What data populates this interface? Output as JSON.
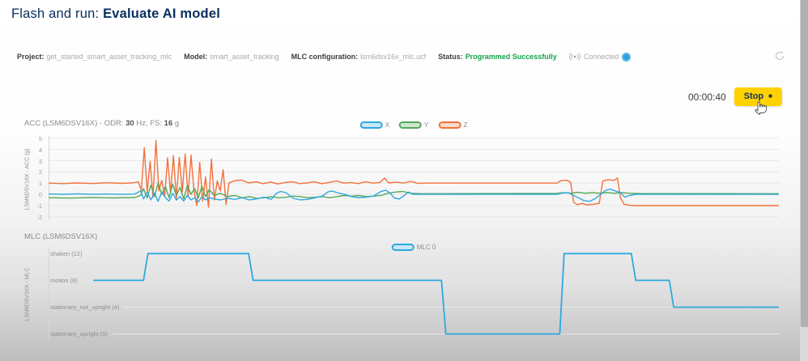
{
  "page": {
    "title_prefix": "Flash and run: ",
    "title_emphasis": "Evaluate AI model"
  },
  "info_bar": {
    "project_label": "Project:",
    "project_value": "get_started_smart_asset_tracking_mlc",
    "model_label": "Model:",
    "model_value": "smart_asset_tracking",
    "mlc_label": "MLC configuration:",
    "mlc_value": "lsm6dsv16x_mlc.ucf",
    "status_label": "Status:",
    "status_value": "Programmed Successfully",
    "connected_label": "Connected"
  },
  "toolbar": {
    "timer": "00:00:40",
    "stop_label": "Stop",
    "stop_glyph": "■"
  },
  "colors": {
    "navy": "#0c2f60",
    "status_green": "#16a34a",
    "stop_yellow": "#ffd200",
    "series_x": "#2ea9e0",
    "series_x_fill": "#c9e7f7",
    "series_y": "#55a85a",
    "series_y_fill": "#cfe6cf",
    "series_z": "#f4713c",
    "series_z_fill": "#fcd9c8",
    "mlc0": "#2ea9e0",
    "mlc0_fill": "#c9e7f7"
  },
  "chart_data": [
    {
      "type": "line",
      "title": {
        "prefix": "ACC (LSM6DSV16X) - ODR: ",
        "odr": "30",
        "mid": " Hz, FS: ",
        "fs": "16",
        "suffix": " g"
      },
      "ylabel": "LSM6DSV16X - ACC (g)",
      "ylim": [
        -2.3,
        5.2
      ],
      "grid": true,
      "legend_position": "top-center",
      "line_width": 1.4,
      "yticks": [
        {
          "value": 5,
          "label": "5"
        },
        {
          "value": 4,
          "label": "4"
        },
        {
          "value": 3,
          "label": "3"
        },
        {
          "value": 2,
          "label": "2"
        },
        {
          "value": 1,
          "label": "1"
        },
        {
          "value": 0,
          "label": "0"
        },
        {
          "value": -1,
          "label": "-1"
        },
        {
          "value": -2,
          "label": "-2"
        }
      ],
      "legend": [
        {
          "label": "X",
          "color_key": "series_x",
          "fill_key": "series_x_fill"
        },
        {
          "label": "Y",
          "color_key": "series_y",
          "fill_key": "series_y_fill"
        },
        {
          "label": "Z",
          "color_key": "series_z",
          "fill_key": "series_z_fill"
        }
      ],
      "series": [
        {
          "name": "Z",
          "color_key": "series_z",
          "points": [
            [
              0,
              1
            ],
            [
              2,
              0.96
            ],
            [
              4,
              1.02
            ],
            [
              6,
              0.97
            ],
            [
              8,
              1.03
            ],
            [
              10,
              0.98
            ],
            [
              11.5,
              1.02
            ],
            [
              12.3,
              1.12
            ],
            [
              12.7,
              0.35
            ],
            [
              13.1,
              4.15
            ],
            [
              13.5,
              0.2
            ],
            [
              13.9,
              2.95
            ],
            [
              14.3,
              -0.25
            ],
            [
              14.7,
              4.8
            ],
            [
              15.1,
              0.3
            ],
            [
              15.5,
              1.25
            ],
            [
              15.9,
              -0.2
            ],
            [
              16.3,
              3.25
            ],
            [
              16.7,
              0.1
            ],
            [
              17.1,
              3.45
            ],
            [
              17.5,
              -0.4
            ],
            [
              17.9,
              3.3
            ],
            [
              18.3,
              0.2
            ],
            [
              18.7,
              3.6
            ],
            [
              19.1,
              -0.2
            ],
            [
              19.5,
              3.5
            ],
            [
              19.9,
              0.4
            ],
            [
              20.3,
              -1
            ],
            [
              20.7,
              2.85
            ],
            [
              21.1,
              -0.6
            ],
            [
              21.5,
              1.55
            ],
            [
              21.9,
              -1.15
            ],
            [
              22.3,
              3.15
            ],
            [
              22.7,
              -0.5
            ],
            [
              23.1,
              1.2
            ],
            [
              23.5,
              0.3
            ],
            [
              23.9,
              2.2
            ],
            [
              24.3,
              -0.9
            ],
            [
              24.7,
              1.0
            ],
            [
              25.4,
              1.2
            ],
            [
              26.4,
              1.28
            ],
            [
              27.4,
              1.02
            ],
            [
              28.4,
              1.12
            ],
            [
              29.4,
              0.95
            ],
            [
              30.4,
              1.1
            ],
            [
              31.4,
              0.92
            ],
            [
              32.4,
              1.06
            ],
            [
              33.4,
              1.12
            ],
            [
              34.4,
              0.96
            ],
            [
              35.4,
              1.02
            ],
            [
              36.4,
              1.12
            ],
            [
              37.4,
              0.95
            ],
            [
              38.4,
              1.06
            ],
            [
              39.4,
              1.2
            ],
            [
              40.4,
              1.0
            ],
            [
              41.4,
              1.06
            ],
            [
              42.4,
              0.96
            ],
            [
              43.4,
              1.12
            ],
            [
              44.4,
              1.0
            ],
            [
              45.4,
              1.06
            ],
            [
              46,
              1.45
            ],
            [
              46.6,
              1.02
            ],
            [
              47.6,
              1.08
            ],
            [
              48.6,
              1.0
            ],
            [
              49.6,
              1.15
            ],
            [
              50.6,
              0.98
            ],
            [
              52,
              1.0
            ],
            [
              69.6,
              1.0
            ],
            [
              70.1,
              1.2
            ],
            [
              71,
              1.26
            ],
            [
              71.5,
              1.05
            ],
            [
              71.9,
              -0.7
            ],
            [
              72.4,
              -0.92
            ],
            [
              73.1,
              -0.8
            ],
            [
              73.7,
              -0.95
            ],
            [
              74.6,
              -0.88
            ],
            [
              75.4,
              -0.8
            ],
            [
              75.9,
              1.18
            ],
            [
              76.6,
              1.3
            ],
            [
              77.4,
              1.24
            ],
            [
              77.9,
              1.45
            ],
            [
              78.3,
              -0.3
            ],
            [
              78.8,
              -0.88
            ],
            [
              79.5,
              -0.97
            ],
            [
              80.5,
              -1
            ],
            [
              100,
              -1
            ]
          ]
        },
        {
          "name": "Y",
          "color_key": "series_y",
          "points": [
            [
              0,
              -0.3
            ],
            [
              3,
              -0.33
            ],
            [
              6,
              -0.29
            ],
            [
              9,
              -0.32
            ],
            [
              11.8,
              -0.29
            ],
            [
              12.6,
              -0.1
            ],
            [
              13,
              0.5
            ],
            [
              13.5,
              -0.3
            ],
            [
              14,
              0.82
            ],
            [
              14.5,
              -0.2
            ],
            [
              15,
              1.02
            ],
            [
              15.5,
              0
            ],
            [
              16,
              0.72
            ],
            [
              16.5,
              -0.3
            ],
            [
              17,
              0.9
            ],
            [
              17.5,
              -0.1
            ],
            [
              18,
              0.62
            ],
            [
              18.5,
              -0.4
            ],
            [
              19,
              0.8
            ],
            [
              19.5,
              0
            ],
            [
              20,
              0.52
            ],
            [
              20.5,
              -0.3
            ],
            [
              21,
              0.7
            ],
            [
              21.5,
              -0.2
            ],
            [
              22,
              0.42
            ],
            [
              22.7,
              -0.1
            ],
            [
              23.5,
              0.1
            ],
            [
              24.5,
              -0.2
            ],
            [
              25.5,
              -0.1
            ],
            [
              26.5,
              -0.3
            ],
            [
              27.5,
              -0.2
            ],
            [
              28.5,
              -0.36
            ],
            [
              29.5,
              -0.3
            ],
            [
              30.5,
              -0.2
            ],
            [
              31.5,
              -0.3
            ],
            [
              32.5,
              -0.26
            ],
            [
              33.5,
              -0.16
            ],
            [
              34.5,
              -0.2
            ],
            [
              35.5,
              -0.3
            ],
            [
              36.5,
              -0.26
            ],
            [
              37.5,
              -0.2
            ],
            [
              38.5,
              -0.3
            ],
            [
              39.5,
              -0.2
            ],
            [
              40.5,
              -0.1
            ],
            [
              41.5,
              -0.16
            ],
            [
              42.5,
              -0.1
            ],
            [
              43.5,
              -0.2
            ],
            [
              44.5,
              -0.16
            ],
            [
              45.5,
              -0.1
            ],
            [
              46.5,
              0.1
            ],
            [
              47.5,
              0.2
            ],
            [
              48.5,
              0.26
            ],
            [
              49.5,
              0.1
            ],
            [
              51,
              0.06
            ],
            [
              69.6,
              0.08
            ],
            [
              70.5,
              0.16
            ],
            [
              71.5,
              0.1
            ],
            [
              72.5,
              0.18
            ],
            [
              73.5,
              0.1
            ],
            [
              74.5,
              0.16
            ],
            [
              75.5,
              0.1
            ],
            [
              76.5,
              0.16
            ],
            [
              77.5,
              0.1
            ],
            [
              78.5,
              0.16
            ],
            [
              79.5,
              0.1
            ],
            [
              81,
              0.07
            ],
            [
              100,
              0.06
            ]
          ]
        },
        {
          "name": "X",
          "color_key": "series_x",
          "points": [
            [
              0,
              0.04
            ],
            [
              2,
              0
            ],
            [
              4,
              0.05
            ],
            [
              6,
              0
            ],
            [
              8,
              0.03
            ],
            [
              10,
              0
            ],
            [
              11.8,
              0.02
            ],
            [
              12.6,
              0.3
            ],
            [
              13,
              -0.4
            ],
            [
              13.5,
              0.2
            ],
            [
              14,
              -0.5
            ],
            [
              14.5,
              0.1
            ],
            [
              15,
              -0.62
            ],
            [
              15.5,
              0.2
            ],
            [
              16,
              -0.3
            ],
            [
              16.5,
              -0.6
            ],
            [
              17,
              0.1
            ],
            [
              17.5,
              -0.52
            ],
            [
              18,
              -0.2
            ],
            [
              18.5,
              -0.6
            ],
            [
              19,
              -0.1
            ],
            [
              19.5,
              -0.5
            ],
            [
              20,
              -0.3
            ],
            [
              20.5,
              -0.68
            ],
            [
              21,
              -0.2
            ],
            [
              21.5,
              -0.5
            ],
            [
              22,
              -0.3
            ],
            [
              22.7,
              -0.42
            ],
            [
              23.5,
              -0.5
            ],
            [
              24.5,
              -0.35
            ],
            [
              25.5,
              -0.45
            ],
            [
              26.5,
              -0.3
            ],
            [
              27.5,
              -0.5
            ],
            [
              28.5,
              -0.4
            ],
            [
              29.5,
              -0.25
            ],
            [
              30.5,
              -0.45
            ],
            [
              31.2,
              0.1
            ],
            [
              31.8,
              0.26
            ],
            [
              32.5,
              0.15
            ],
            [
              33.5,
              -0.35
            ],
            [
              34.5,
              -0.5
            ],
            [
              35.5,
              -0.45
            ],
            [
              36.5,
              -0.3
            ],
            [
              37.5,
              -0.15
            ],
            [
              38.2,
              0.2
            ],
            [
              38.8,
              0.3
            ],
            [
              39.5,
              0.15
            ],
            [
              40.5,
              0
            ],
            [
              41.5,
              -0.2
            ],
            [
              42.5,
              -0.3
            ],
            [
              43.5,
              -0.25
            ],
            [
              44.5,
              -0.15
            ],
            [
              45.5,
              0.25
            ],
            [
              46.2,
              0.36
            ],
            [
              46.8,
              0.1
            ],
            [
              47.3,
              -0.3
            ],
            [
              48,
              -0.42
            ],
            [
              48.7,
              -0.1
            ],
            [
              49.3,
              0.2
            ],
            [
              49.9,
              0
            ],
            [
              52,
              0
            ],
            [
              69.6,
              0
            ],
            [
              70.3,
              0.1
            ],
            [
              71.1,
              0.16
            ],
            [
              71.9,
              -0.1
            ],
            [
              72.6,
              -0.32
            ],
            [
              73.3,
              -0.56
            ],
            [
              74.1,
              -0.62
            ],
            [
              74.9,
              -0.36
            ],
            [
              75.6,
              0
            ],
            [
              76.3,
              0.36
            ],
            [
              76.9,
              0.46
            ],
            [
              77.6,
              0.3
            ],
            [
              78.3,
              0.16
            ],
            [
              78.9,
              -0.26
            ],
            [
              79.5,
              -0.1
            ],
            [
              80.5,
              0
            ],
            [
              100,
              0
            ]
          ]
        }
      ]
    },
    {
      "type": "line",
      "title": "MLC (LSM6DSV16X)",
      "ylabel": "LSM6DSV16X - MLC",
      "ylim": [
        -0.9,
        13.0
      ],
      "grid": true,
      "legend_position": "top-center",
      "line_width": 1.8,
      "ticks_inside": true,
      "yticks": [
        {
          "value": 12,
          "label": "shaken (12)"
        },
        {
          "value": 8,
          "label": "motion (8)"
        },
        {
          "value": 4,
          "label": "stationary_not_upright (4)"
        },
        {
          "value": 0,
          "label": "stationary_upright (0)"
        }
      ],
      "legend": [
        {
          "label": "MLC 0",
          "color_key": "mlc0",
          "fill_key": "mlc0_fill"
        }
      ],
      "series": [
        {
          "name": "MLC 0",
          "color_key": "mlc0",
          "points": [
            [
              6.2,
              8
            ],
            [
              13,
              8
            ],
            [
              13.6,
              12
            ],
            [
              27.4,
              12
            ],
            [
              28,
              8
            ],
            [
              53.8,
              8
            ],
            [
              54.4,
              0
            ],
            [
              70,
              0
            ],
            [
              70.6,
              12
            ],
            [
              79.8,
              12
            ],
            [
              80.4,
              8
            ],
            [
              85,
              8
            ],
            [
              85.6,
              4
            ],
            [
              100,
              4
            ]
          ]
        }
      ]
    }
  ]
}
